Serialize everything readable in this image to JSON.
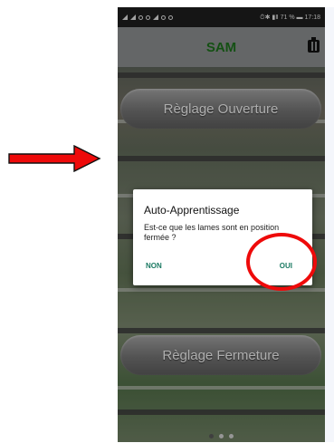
{
  "status_bar": {
    "left_icons": [
      "signal-icon",
      "signal-icon",
      "wifi-icon",
      "settings-icon",
      "warning-icon",
      "upload-icon",
      "settings-icon"
    ],
    "right_text": "⏱✱ ▮Ⅱ 71 % ▬ 17:18"
  },
  "app_bar": {
    "title": "SAM",
    "icon": "battery-icon"
  },
  "buttons": {
    "top_label": "Règlage Ouverture",
    "bottom_label": "Règlage Fermeture"
  },
  "dialog": {
    "title": "Auto-Apprentissage",
    "message": "Est-ce que les lames sont en position fermée ?",
    "negative_label": "NON",
    "positive_label": "OUI"
  },
  "pager": {
    "pages": 3,
    "active_index": 0
  },
  "annotation_colors": {
    "arrow": "#ee0a0a",
    "circle": "#ee0a0a"
  }
}
